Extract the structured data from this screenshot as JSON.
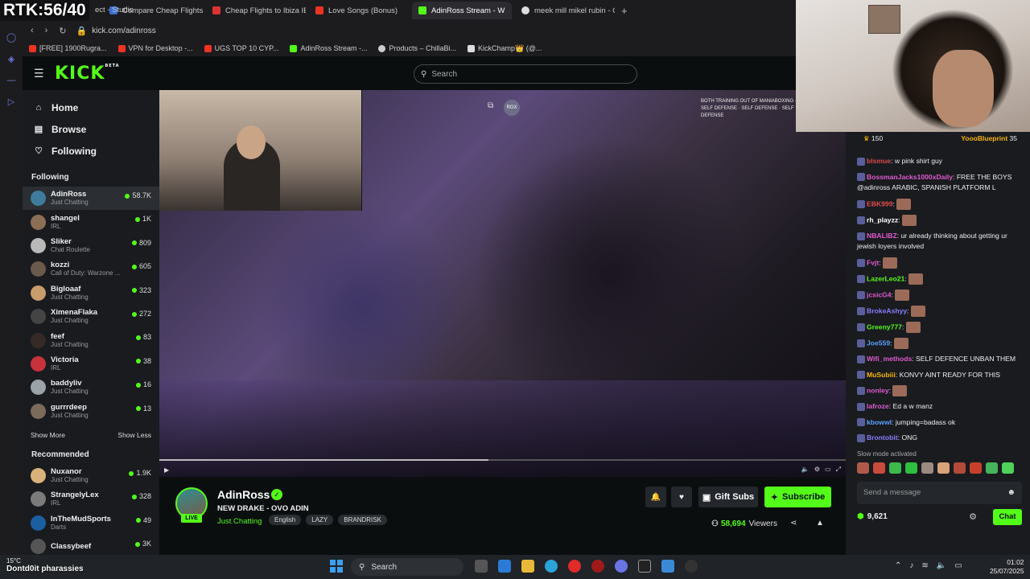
{
  "overlay": {
    "rtk": "RTK:56/40"
  },
  "browser": {
    "tabs": [
      {
        "label": "ect - Studio",
        "color": "#c33"
      },
      {
        "label": "Compare Cheap Flights &",
        "color": "#3b6fd1"
      },
      {
        "label": "Cheap Flights to Ibiza IBZ",
        "color": "#d33"
      },
      {
        "label": "Love Songs (Bonus)",
        "color": "#e32"
      },
      {
        "label": "AdinRoss Stream - W",
        "color": "#53fc18"
      },
      {
        "label": "meek mill mikel rubin - G",
        "color": "#ddd"
      }
    ],
    "url": "kick.com/adinross",
    "bookmarks": [
      {
        "label": "[FREE] 1900Rugra...",
        "color": "#e32"
      },
      {
        "label": "VPN for Desktop -...",
        "color": "#e32"
      },
      {
        "label": "UGS TOP 10 CYP...",
        "color": "#e32"
      },
      {
        "label": "AdinRoss Stream -...",
        "color": "#53fc18"
      },
      {
        "label": "Products – ChillaBi...",
        "color": "#ccc"
      },
      {
        "label": "KickChamp👑 (@...",
        "color": "#ddd"
      }
    ]
  },
  "header": {
    "logo": "KICK",
    "logo_sup": "BETA",
    "search_placeholder": "Search"
  },
  "sidebar": {
    "nav": [
      {
        "label": "Home",
        "icon": "home-icon"
      },
      {
        "label": "Browse",
        "icon": "browse-icon"
      },
      {
        "label": "Following",
        "icon": "heart-icon"
      }
    ],
    "following_heading": "Following",
    "following": [
      {
        "name": "AdinRoss",
        "category": "Just Chatting",
        "viewers": "58.7K",
        "color": "#3f7c9c"
      },
      {
        "name": "shangel",
        "category": "IRL",
        "viewers": "1K",
        "color": "#8a6e55"
      },
      {
        "name": "Sliker",
        "category": "Chat Roulette",
        "viewers": "809",
        "color": "#b9b9b9"
      },
      {
        "name": "kozzi",
        "category": "Call of Duty: Warzone ...",
        "viewers": "605",
        "color": "#6b5a4c"
      },
      {
        "name": "Bigloaaf",
        "category": "Just Chatting",
        "viewers": "323",
        "color": "#c89c6c"
      },
      {
        "name": "XimenaFlaka",
        "category": "Just Chatting",
        "viewers": "272",
        "color": "#444"
      },
      {
        "name": "feef",
        "category": "Just Chatting",
        "viewers": "83",
        "color": "#352a25"
      },
      {
        "name": "Victoria",
        "category": "IRL",
        "viewers": "38",
        "color": "#c8323c"
      },
      {
        "name": "baddyliv",
        "category": "Just Chatting",
        "viewers": "16",
        "color": "#9aa3a8"
      },
      {
        "name": "gurrrdeep",
        "category": "Just Chatting",
        "viewers": "13",
        "color": "#7c6b5a"
      }
    ],
    "show_more": "Show More",
    "show_less": "Show Less",
    "recommended_heading": "Recommended",
    "recommended": [
      {
        "name": "Nuxanor",
        "category": "Just Chatting",
        "viewers": "1.9K",
        "color": "#d8b27a"
      },
      {
        "name": "StrangelyLex",
        "category": "IRL",
        "viewers": "328",
        "color": "#7b7b7b"
      },
      {
        "name": "InTheMudSports",
        "category": "Darts",
        "viewers": "49",
        "color": "#1c5fa0"
      },
      {
        "name": "Classybeef",
        "category": "",
        "viewers": "3K",
        "color": "#555"
      }
    ]
  },
  "player": {
    "overlay_text": "BOTH TRAINING OUT OF MANIABOXING · SELF DEFENSE · SELF DEFENSE · SELF DEFENSE",
    "badge": "RGX",
    "progress": 0.48
  },
  "stream": {
    "name": "AdinRoss",
    "live_label": "LIVE",
    "title": "NEW DRAKE - OVO ADIN",
    "category": "Just Chatting",
    "tags": [
      "English",
      "LAZY",
      "BRANDRISK"
    ],
    "gift_label": "Gift Subs",
    "subscribe_label": "Subscribe",
    "viewers": "58,694",
    "viewers_label": "Viewers"
  },
  "chat": {
    "header_left_count": "150",
    "header_user": "YoooBlueprint",
    "header_right_count": "35",
    "messages": [
      {
        "user": "blsmue",
        "text": "w pink shirt guy",
        "color": "#d94c4c"
      },
      {
        "user": "BossmanJacks1000xDaily",
        "text": "FREE THE BOYS @adinross ARABIC, SPANISH PLATFORM L",
        "color": "#e05ad0"
      },
      {
        "user": "EBK999",
        "text": "",
        "color": "#e84c4c"
      },
      {
        "user": "rh_playzz",
        "text": "",
        "color": "#ffffff"
      },
      {
        "user": "NBALIBZ",
        "text": "ur already thinking about getting ur jewish loyers involved",
        "color": "#e05ad0"
      },
      {
        "user": "Fvjt",
        "text": "",
        "color": "#e05ad0"
      },
      {
        "user": "LazerLeo21",
        "text": "",
        "color": "#53fc18"
      },
      {
        "user": "jcsicG4",
        "text": "",
        "color": "#e05ad0"
      },
      {
        "user": "BrokeAshyy",
        "text": "",
        "color": "#8a7cff"
      },
      {
        "user": "Greeny777",
        "text": "",
        "color": "#53fc18"
      },
      {
        "user": "Joe559",
        "text": "",
        "color": "#5aa0ff"
      },
      {
        "user": "Wifi_methods",
        "text": "SELF DEFENCE UNBAN THEM",
        "color": "#e05ad0"
      },
      {
        "user": "MuSubiii",
        "text": "KONVY AINT READY FOR THIS",
        "color": "#f5b400"
      },
      {
        "user": "nonley",
        "text": "",
        "color": "#e05ad0"
      },
      {
        "user": "lafroze",
        "text": "Ed a w manz",
        "color": "#e05ad0"
      },
      {
        "user": "kbowwl",
        "text": "jumping=badass ok",
        "color": "#5aa0ff"
      },
      {
        "user": "Brontobit",
        "text": "ONG",
        "color": "#8a7cff"
      }
    ],
    "slow_mode": "Slow mode activated",
    "send_placeholder": "Send a message",
    "points": "9,621",
    "chat_button": "Chat"
  },
  "taskbar": {
    "weather_temp": "15°C",
    "overlay_user": "Dontd0it pharassies",
    "search_label": "Search",
    "time": "01:02",
    "date": "25/07/2025"
  }
}
